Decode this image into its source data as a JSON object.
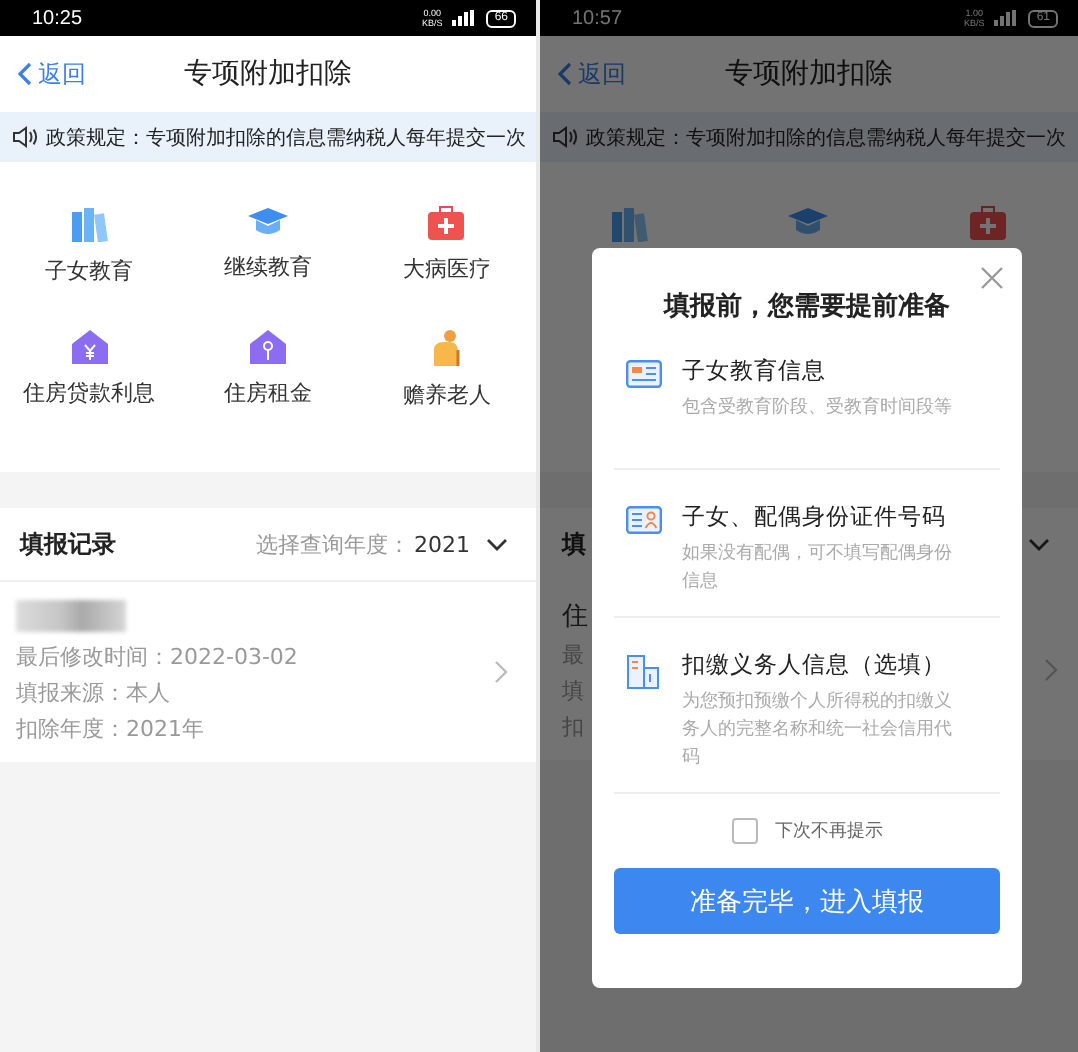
{
  "left_screen": {
    "status_bar": {
      "time": "10:25",
      "speed_value": "0.00",
      "speed_unit": "KB/S",
      "battery": "66"
    },
    "nav": {
      "back": "返回",
      "title": "专项附加扣除"
    },
    "notice": "政策规定：专项附加扣除的信息需纳税人每年提交一次",
    "categories": [
      {
        "kind": "books",
        "label": "子女教育"
      },
      {
        "kind": "cap",
        "label": "继续教育"
      },
      {
        "kind": "medkit",
        "label": "大病医疗"
      },
      {
        "kind": "house-yen",
        "label": "住房贷款利息"
      },
      {
        "kind": "house-key",
        "label": "住房租金"
      },
      {
        "kind": "elder",
        "label": "赡养老人"
      }
    ],
    "records": {
      "title": "填报记录",
      "filter_label": "选择查询年度：",
      "year": "2021",
      "items": [
        {
          "lines": [
            "最后修改时间：2022-03-02",
            "填报来源：本人",
            "扣除年度：2021年"
          ]
        }
      ]
    }
  },
  "right_screen": {
    "status_bar": {
      "time": "10:57",
      "speed_value": "1.00",
      "speed_unit": "KB/S",
      "battery": "61"
    },
    "nav": {
      "back": "返回",
      "title": "专项附加扣除"
    },
    "notice": "政策规定：专项附加扣除的信息需纳税人每年提交一次",
    "category_icons": [
      {
        "kind": "books"
      },
      {
        "kind": "cap"
      },
      {
        "kind": "medkit"
      }
    ],
    "records_title_fragment": "填",
    "record_title_fragment": "住",
    "record_line_fragments": [
      "最",
      "填",
      "扣"
    ],
    "modal": {
      "title": "填报前，您需要提前准备",
      "items": [
        {
          "kind": "card",
          "title": "子女教育信息",
          "description": "包含受教育阶段、受教育时间段等"
        },
        {
          "kind": "id",
          "title": "子女、配偶身份证件号码",
          "description": "如果没有配偶，可不填写配偶身份信息"
        },
        {
          "kind": "building",
          "title": "扣缴义务人信息（选填）",
          "description": "为您预扣预缴个人所得税的扣缴义务人的完整名称和统一社会信用代码"
        }
      ],
      "checkbox": {
        "label": "下次不再提示",
        "checked": false
      },
      "button": "准备完毕，进入填报"
    }
  }
}
